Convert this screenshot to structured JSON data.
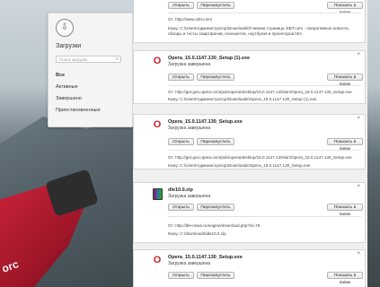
{
  "sidebar": {
    "title": "Загрузки",
    "search_placeholder": "Поиск загрузок",
    "items": [
      {
        "label": "Все",
        "active": true
      },
      {
        "label": "Активные",
        "active": false
      },
      {
        "label": "Завершено",
        "active": false
      },
      {
        "label": "Приостановленные",
        "active": false
      }
    ]
  },
  "buttons": {
    "open": "Открыть",
    "restart": "Перезапустить",
    "show_in_folder": "Показать в папке"
  },
  "downloads": [
    {
      "name": "",
      "status": "",
      "from_label": "От:",
      "from": "http://www.ixbt.com/",
      "where_label": "Кому:",
      "where": "C:\\Users\\Администратор\\Downloads\\Главная страница iXBT.com - оперативные новости, обзоры и тесты смартфонов, планшетов, ноутбуков и проекторов.htm",
      "icon": "html-file-icon"
    },
    {
      "name": "Opera_15.0.1147.130_Setup (1).exe",
      "status": "Загрузка завершена",
      "from_label": "От:",
      "from": "http://get.geo.opera.com/pub/opera/desktop/15.0.1147.130/win/Opera_15.0.1147.130_Setup.exe",
      "where_label": "Кому:",
      "where": "C:\\Users\\Администратор\\Downloads\\Opera_15.0.1147.130_Setup (1).exe",
      "icon": "opera-icon"
    },
    {
      "name": "Opera_15.0.1147.130_Setup.exe",
      "status": "Загрузка завершена",
      "from_label": "От:",
      "from": "http://get.geo.opera.com/pub/opera/desktop/15.0.1147.130/win/Opera_15.0.1147.130_Setup.exe",
      "where_label": "Кому:",
      "where": "C:\\Users\\Администратор\\Downloads\\Opera_15.0.1147.130_Setup.exe",
      "icon": "opera-icon"
    },
    {
      "name": "dle10.0.zip",
      "status": "Загрузка завершена",
      "from_label": "От:",
      "from": "http://dle-news.ru/engine/download.php?id=76",
      "where_label": "Кому:",
      "where": "C:\\downloads\\dle10.0.zip",
      "icon": "winrar-icon"
    },
    {
      "name": "Opera_15.0.1147.130_Setup.exe",
      "status": "Загрузка завершена",
      "icon": "opera-icon"
    }
  ],
  "background_logo": "orc"
}
